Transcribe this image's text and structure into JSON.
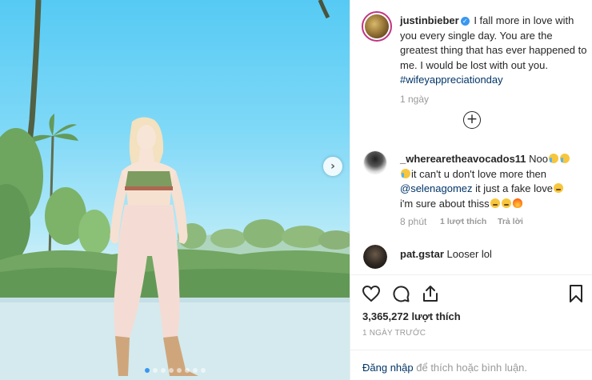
{
  "post": {
    "author": "justinbieber",
    "caption_text": "I fall more in love with you every single day. You are the greatest thing that has ever happened to me. I would be lost with out you.",
    "caption_tag": "#wifeyappreciationday",
    "time_ago": "1 ngày"
  },
  "comments": [
    {
      "username": "_wherearetheavocados11",
      "text_a": "Noo",
      "text_b": "it can't u don't love more then",
      "mention": "@selenagomez",
      "text_c": "it just a fake love",
      "text_d": "i'm sure about thiss",
      "time": "8 phút",
      "likes": "1 lượt thích",
      "reply": "Trả lời"
    },
    {
      "username": "pat.gstar",
      "text": "Looser lol"
    }
  ],
  "actions": {
    "like_icon": "heart-icon",
    "comment_icon": "comment-icon",
    "share_icon": "share-icon",
    "save_icon": "bookmark-icon"
  },
  "stats": {
    "likes": "3,365,272 lượt thích",
    "posted": "1 NGÀY TRƯỚC"
  },
  "footer": {
    "login_link": "Đăng nhập",
    "login_suffix": "để thích hoặc bình luận."
  },
  "carousel": {
    "count": 8,
    "active": 0,
    "next_icon": "chevron-right-icon"
  },
  "colors": {
    "link": "#003569",
    "muted": "#999999",
    "verified": "#3897f0",
    "active_dot": "#3897f0"
  }
}
